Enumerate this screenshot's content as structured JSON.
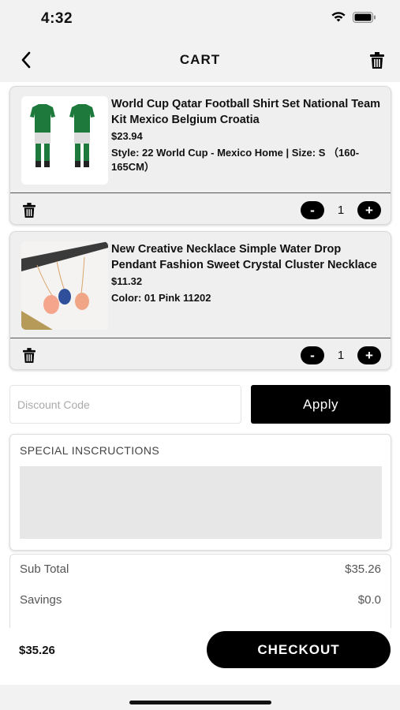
{
  "status_bar": {
    "time": "4:32"
  },
  "nav": {
    "title": "CART"
  },
  "items": [
    {
      "name": "World Cup Qatar Football Shirt Set National Team Kit Mexico Belgium Croatia",
      "price": "$23.94",
      "variant": "Style: 22 World Cup - Mexico Home | Size: S （160-165CM）",
      "quantity": "1"
    },
    {
      "name": "New Creative Necklace Simple Water Drop Pendant Fashion Sweet Crystal Cluster Necklace",
      "price": "$11.32",
      "variant": "Color: 01 Pink 11202",
      "quantity": "1"
    }
  ],
  "qty_labels": {
    "minus": "-",
    "plus": "+"
  },
  "discount": {
    "placeholder": "Discount Code",
    "apply_label": "Apply"
  },
  "instructions": {
    "title": "SPECIAL INSCRUCTIONS"
  },
  "summary": {
    "subtotal_label": "Sub Total",
    "subtotal_value": "$35.26",
    "savings_label": "Savings",
    "savings_value": "$0.0"
  },
  "bottom": {
    "total": "$35.26",
    "checkout_label": "CHECKOUT"
  }
}
